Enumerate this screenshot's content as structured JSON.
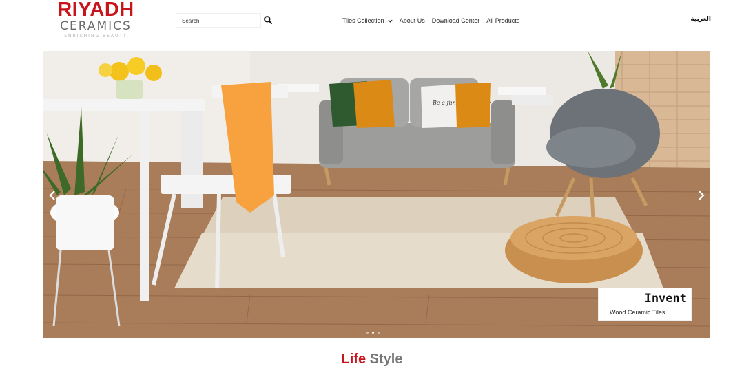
{
  "brand": {
    "name_main": "RIYADH",
    "name_sub": "CERAMICS",
    "tagline": "ENRICHING BEAUTY",
    "primary_color": "#c8151b"
  },
  "search": {
    "placeholder": "Search",
    "icon": "search-icon"
  },
  "nav": {
    "items": [
      {
        "label": "Tiles Collection",
        "has_dropdown": true
      },
      {
        "label": "About Us"
      },
      {
        "label": "Download Center"
      },
      {
        "label": "All Products"
      }
    ],
    "language": "العربية"
  },
  "hero": {
    "slide_title": "Invent",
    "slide_subtitle": "Wood Ceramic Tiles",
    "pillow_text": "Be a fun happy place",
    "slides_count": 3,
    "active_slide": 2,
    "prev_icon": "chevron-left-icon",
    "next_icon": "chevron-right-icon"
  },
  "section": {
    "title_accent": "Life",
    "title_rest": "Style"
  }
}
